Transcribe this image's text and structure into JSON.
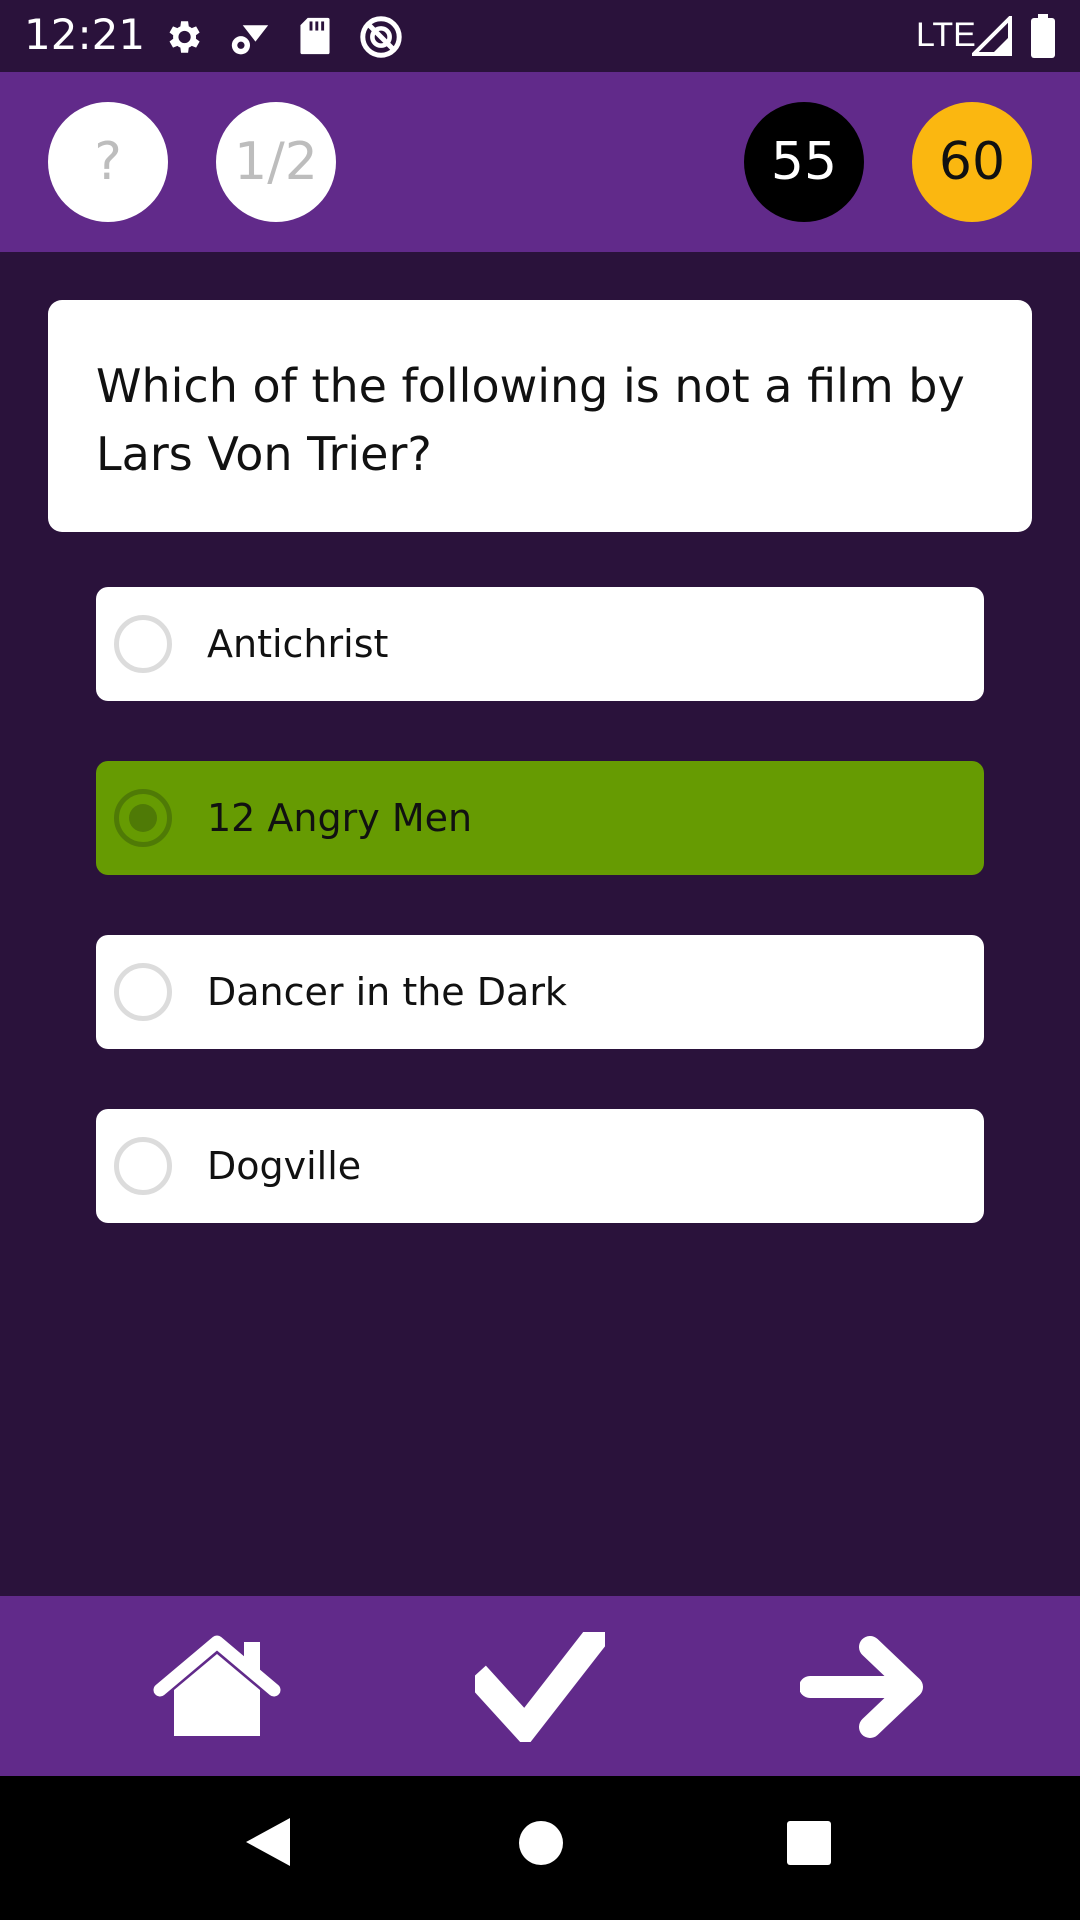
{
  "status_bar": {
    "time": "12:21",
    "network": "LTE",
    "icons": [
      "gear-icon",
      "wifi-settings-icon",
      "sd-card-icon",
      "no-disturb-icon",
      "signal-icon",
      "battery-icon"
    ]
  },
  "header": {
    "help_label": "?",
    "lifeline_label": "1/2",
    "timer": "55",
    "score": "60"
  },
  "question": {
    "text": "Which of the following is not a film by Lars Von Trier?"
  },
  "answers": [
    {
      "label": "Antichrist",
      "selected": false
    },
    {
      "label": "12 Angry Men",
      "selected": true
    },
    {
      "label": "Dancer in the Dark",
      "selected": false
    },
    {
      "label": "Dogville",
      "selected": false
    }
  ],
  "toolbar": {
    "icons": [
      "home-icon",
      "check-icon",
      "arrow-right-icon"
    ]
  },
  "nav_bar": {
    "icons": [
      "back-icon",
      "home-circle-icon",
      "recents-icon"
    ]
  },
  "colors": {
    "background": "#2a123b",
    "header": "#612a8a",
    "selected_answer": "#669b02",
    "score_badge": "#fbb710",
    "timer_badge": "#000000"
  }
}
